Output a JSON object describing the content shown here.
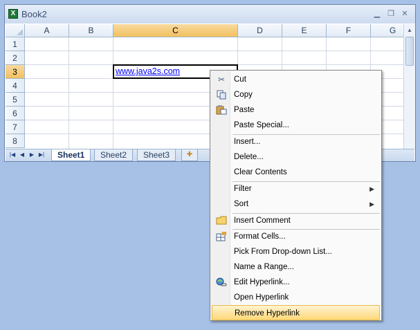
{
  "window": {
    "title": "Book2",
    "icon": "excel-icon"
  },
  "columns": [
    {
      "label": "A",
      "selected": false
    },
    {
      "label": "B",
      "selected": false
    },
    {
      "label": "C",
      "selected": true
    },
    {
      "label": "D",
      "selected": false
    },
    {
      "label": "E",
      "selected": false
    },
    {
      "label": "F",
      "selected": false
    },
    {
      "label": "G",
      "selected": false
    }
  ],
  "rows": [
    "1",
    "2",
    "3",
    "4",
    "5",
    "6",
    "7",
    "8"
  ],
  "selected_row": "3",
  "active_cell": {
    "ref": "C3",
    "value": "www.java2s.com"
  },
  "sheet_tabs": [
    {
      "label": "Sheet1",
      "active": true
    },
    {
      "label": "Sheet2",
      "active": false
    },
    {
      "label": "Sheet3",
      "active": false
    }
  ],
  "context_menu": {
    "items": [
      {
        "label": "Cut",
        "icon": "scissors-icon",
        "name": "cut"
      },
      {
        "label": "Copy",
        "icon": "copy-icon",
        "name": "copy"
      },
      {
        "label": "Paste",
        "icon": "paste-icon",
        "name": "paste"
      },
      {
        "label": "Paste Special...",
        "icon": "",
        "name": "paste-special"
      },
      {
        "label": "Insert...",
        "icon": "",
        "name": "insert"
      },
      {
        "label": "Delete...",
        "icon": "",
        "name": "delete"
      },
      {
        "label": "Clear Contents",
        "icon": "",
        "name": "clear-contents"
      },
      {
        "label": "Filter",
        "icon": "",
        "name": "filter",
        "submenu": true
      },
      {
        "label": "Sort",
        "icon": "",
        "name": "sort",
        "submenu": true
      },
      {
        "label": "Insert Comment",
        "icon": "comment-icon",
        "name": "insert-comment"
      },
      {
        "label": "Format Cells...",
        "icon": "format-cells-icon",
        "name": "format-cells"
      },
      {
        "label": "Pick From Drop-down List...",
        "icon": "",
        "name": "pick-from-list"
      },
      {
        "label": "Name a Range...",
        "icon": "",
        "name": "name-range"
      },
      {
        "label": "Edit Hyperlink...",
        "icon": "hyperlink-icon",
        "name": "edit-hyperlink"
      },
      {
        "label": "Open Hyperlink",
        "icon": "",
        "name": "open-hyperlink"
      },
      {
        "label": "Remove Hyperlink",
        "icon": "",
        "name": "remove-hyperlink",
        "highlighted": true
      }
    ]
  },
  "colors": {
    "desktop": "#a7c1e6",
    "selected_header": "#f1c15f",
    "menu_highlight": "#ffd97a",
    "link": "#0000ff"
  }
}
